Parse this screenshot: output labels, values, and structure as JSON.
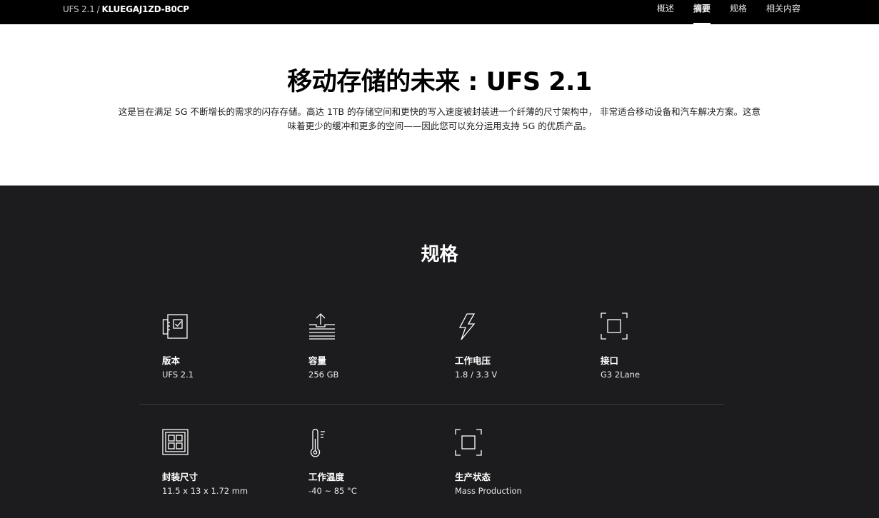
{
  "header": {
    "breadcrumb_parent": "UFS 2.1",
    "breadcrumb_separator": "/",
    "breadcrumb_current": "KLUEGAJ1ZD-B0CP",
    "nav": [
      {
        "label": "概述",
        "active": false
      },
      {
        "label": "摘要",
        "active": true
      },
      {
        "label": "规格",
        "active": false
      },
      {
        "label": "相关内容",
        "active": false
      }
    ]
  },
  "hero": {
    "title": "移动存储的未来 : UFS 2.1",
    "description": "这是旨在满足 5G 不断增长的需求的闪存存储。高达 1TB 的存储空间和更快的写入速度被封装进一个纤薄的尺寸架构中， 非常适合移动设备和汽车解决方案。这意味着更少的缓冲和更多的空间——因此您可以充分运用支持 5G 的优质产品。"
  },
  "specs": {
    "title": "规格",
    "items": [
      {
        "icon": "version-icon",
        "label": "版本",
        "value": "UFS 2.1"
      },
      {
        "icon": "capacity-icon",
        "label": "容量",
        "value": "256 GB"
      },
      {
        "icon": "voltage-icon",
        "label": "工作电压",
        "value": "1.8 / 3.3 V"
      },
      {
        "icon": "interface-icon",
        "label": "接口",
        "value": "G3 2Lane"
      },
      {
        "icon": "package-size-icon",
        "label": "封装尺寸",
        "value": "11.5 x 13 x 1.72 mm"
      },
      {
        "icon": "temperature-icon",
        "label": "工作温度",
        "value": "-40 ~ 85 °C"
      },
      {
        "icon": "production-status-icon",
        "label": "生产状态",
        "value": "Mass Production"
      }
    ]
  },
  "colors": {
    "topbar_bg": "#000000",
    "hero_bg": "#ffffff",
    "specs_bg": "#1c1c1e",
    "divider": "#3c3c3e"
  }
}
